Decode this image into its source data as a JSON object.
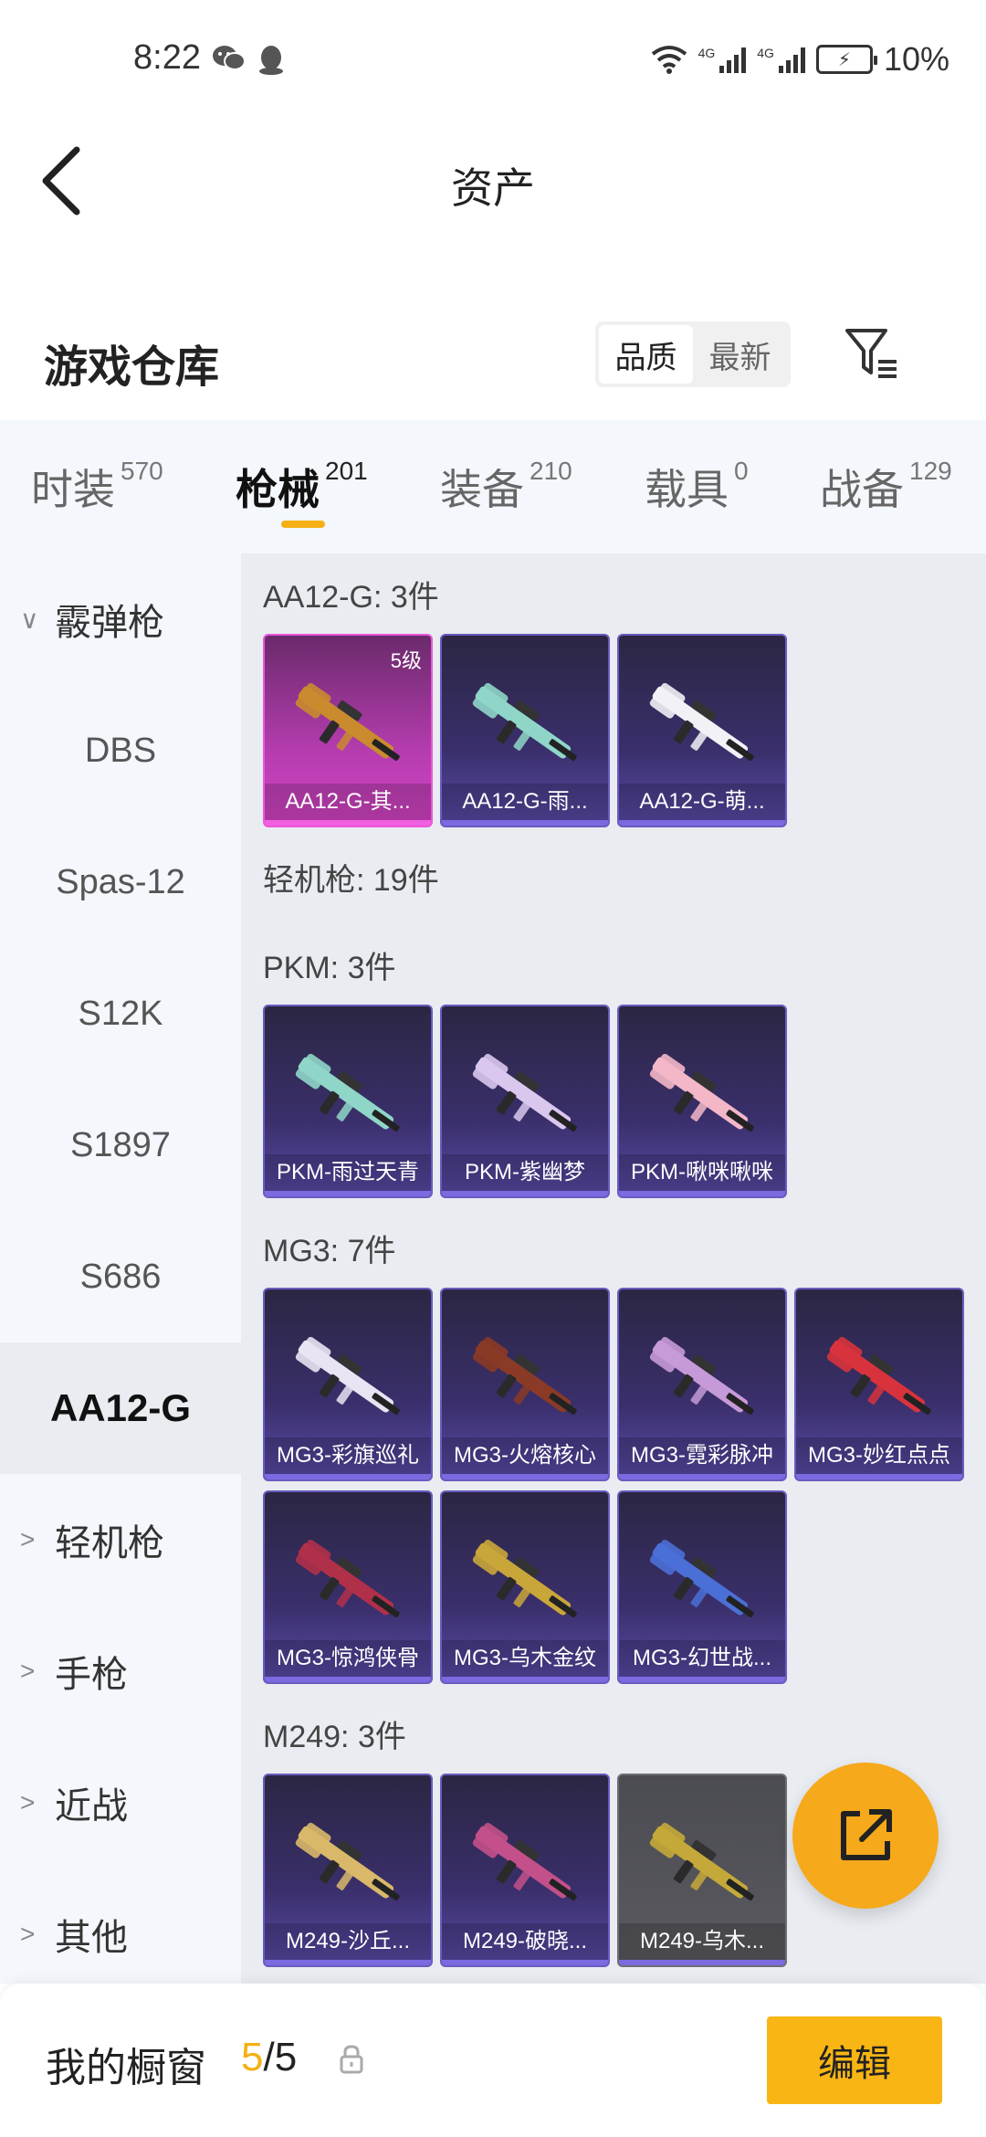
{
  "status": {
    "time": "8:22",
    "battery": "10%",
    "net1": "4G",
    "net2": "4G"
  },
  "header": {
    "title": "资产"
  },
  "section": {
    "title": "游戏仓库",
    "sort": [
      "品质",
      "最新"
    ],
    "sort_selected": "品质"
  },
  "tabs": [
    {
      "label": "时装",
      "count": "570"
    },
    {
      "label": "枪械",
      "count": "201"
    },
    {
      "label": "装备",
      "count": "210"
    },
    {
      "label": "载具",
      "count": "0"
    },
    {
      "label": "战备",
      "count": "129"
    }
  ],
  "sidebar": [
    {
      "label": "霰弹枪",
      "type": "cat",
      "expanded": true
    },
    {
      "label": "DBS",
      "type": "sub"
    },
    {
      "label": "Spas-12",
      "type": "sub"
    },
    {
      "label": "S12K",
      "type": "sub"
    },
    {
      "label": "S1897",
      "type": "sub"
    },
    {
      "label": "S686",
      "type": "sub"
    },
    {
      "label": "AA12-G",
      "type": "sub",
      "active": true
    },
    {
      "label": "轻机枪",
      "type": "cat"
    },
    {
      "label": "手枪",
      "type": "cat"
    },
    {
      "label": "近战",
      "type": "cat"
    },
    {
      "label": "其他",
      "type": "cat"
    }
  ],
  "groups": {
    "aa12": {
      "title": "AA12-G: 3件",
      "cards": [
        {
          "name": "AA12-G-其...",
          "level": "5级",
          "style": "pink",
          "color": "#c98b2e"
        },
        {
          "name": "AA12-G-雨...",
          "style": "purple",
          "color": "#8fd6c8"
        },
        {
          "name": "AA12-G-萌...",
          "style": "purple",
          "color": "#f1f1f6"
        }
      ]
    },
    "lmg_title": "轻机枪: 19件",
    "pkm": {
      "title": "PKM: 3件",
      "cards": [
        {
          "name": "PKM-雨过天青",
          "style": "purple",
          "color": "#8fd6c8"
        },
        {
          "name": "PKM-紫幽梦",
          "style": "purple",
          "color": "#d9c7ee"
        },
        {
          "name": "PKM-啾咪啾咪",
          "style": "purple",
          "color": "#f3b7c8"
        }
      ]
    },
    "mg3": {
      "title": "MG3: 7件",
      "cards": [
        {
          "name": "MG3-彩旗巡礼",
          "style": "purple",
          "color": "#e9e3f3"
        },
        {
          "name": "MG3-火熔核心",
          "style": "purple",
          "color": "#8a3a26"
        },
        {
          "name": "MG3-霓彩脉冲",
          "style": "purple",
          "color": "#c69ad8"
        },
        {
          "name": "MG3-妙红点点",
          "style": "purple",
          "color": "#d8333c"
        },
        {
          "name": "MG3-惊鸿侠骨",
          "style": "purple",
          "color": "#b0304a"
        },
        {
          "name": "MG3-乌木金纹",
          "style": "purple",
          "color": "#c9a63a"
        },
        {
          "name": "MG3-幻世战...",
          "style": "purple",
          "color": "#4a6fd6"
        }
      ]
    },
    "m249": {
      "title": "M249: 3件",
      "cards": [
        {
          "name": "M249-沙丘...",
          "style": "purple",
          "color": "#d9b86a"
        },
        {
          "name": "M249-破晓...",
          "style": "purple",
          "color": "#c3508a"
        },
        {
          "name": "M249-乌木...",
          "style": "gray",
          "color": "#c4a83a"
        }
      ]
    }
  },
  "bottom": {
    "title": "我的橱窗",
    "current": "5",
    "total": "/5",
    "edit_label": "编辑"
  }
}
